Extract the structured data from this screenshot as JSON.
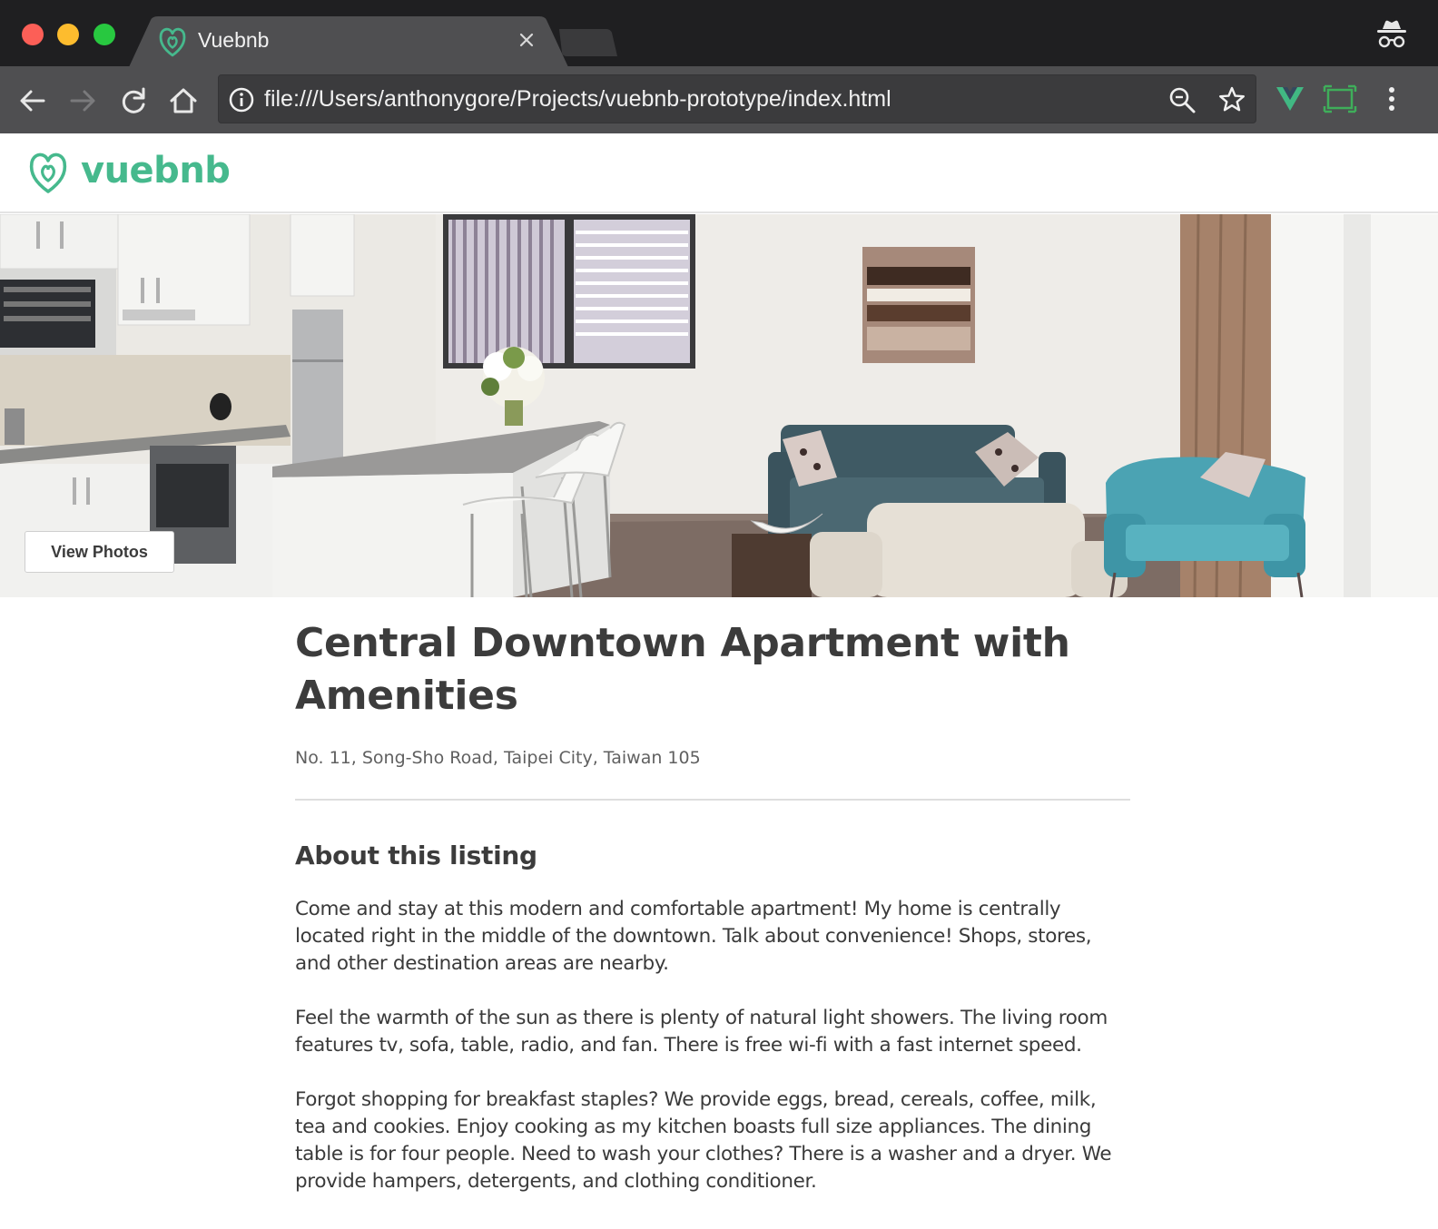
{
  "browser": {
    "tab_title": "Vuebnb",
    "url": "file:///Users/anthonygore/Projects/vuebnb-prototype/index.html",
    "icons": [
      "back-arrow-icon",
      "forward-arrow-icon",
      "reload-icon",
      "home-icon",
      "info-icon",
      "zoom-icon",
      "bookmark-star-icon",
      "vue-devtools-icon",
      "screen-capture-icon",
      "menu-dots-icon",
      "incognito-icon"
    ]
  },
  "header": {
    "logo_text": "vuebnb",
    "brand_color": "#46b98d"
  },
  "hero": {
    "view_photos_label": "View Photos"
  },
  "listing": {
    "title": "Central Downtown Apartment with Amenities",
    "address": "No. 11, Song-Sho Road, Taipei City, Taiwan 105",
    "about_heading": "About this listing",
    "paragraphs": [
      "Come and stay at this modern and comfortable apartment! My home is centrally located right in the middle of the downtown. Talk about convenience! Shops, stores, and other destination areas are nearby.",
      "Feel the warmth of the sun as there is plenty of natural light showers. The living room features tv, sofa, table, radio, and fan. There is free wi-fi with a fast internet speed.",
      "Forgot shopping for breakfast staples? We provide eggs, bread, cereals, coffee, milk, tea and cookies. Enjoy cooking as my kitchen boasts full size appliances. The dining table is for four people. Need to wash your clothes? There is a washer and a dryer. We provide hampers, detergents, and clothing conditioner."
    ]
  }
}
